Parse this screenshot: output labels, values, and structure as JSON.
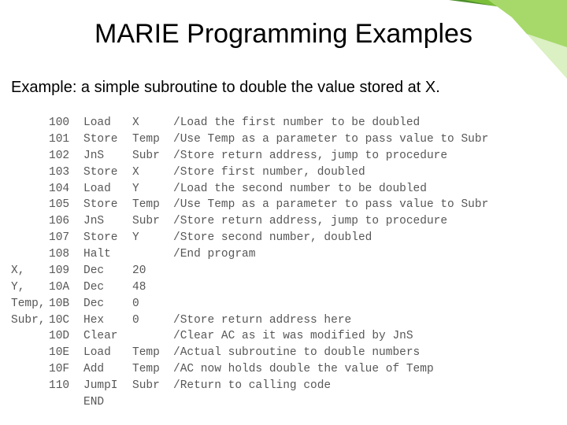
{
  "title": "MARIE Programming Examples",
  "subtitle": "Example: a simple subroutine to double the value stored at X.",
  "code": [
    {
      "label": "",
      "addr": "100",
      "op": "Load",
      "arg": "X",
      "comment": "/Load the first number to be doubled"
    },
    {
      "label": "",
      "addr": "101",
      "op": "Store",
      "arg": "Temp",
      "comment": "/Use Temp as a parameter to pass value to Subr"
    },
    {
      "label": "",
      "addr": "102",
      "op": "JnS",
      "arg": "Subr",
      "comment": "/Store return address, jump to procedure"
    },
    {
      "label": "",
      "addr": "103",
      "op": "Store",
      "arg": "X",
      "comment": "/Store first number, doubled"
    },
    {
      "label": "",
      "addr": "104",
      "op": "Load",
      "arg": "Y",
      "comment": "/Load the second number to be doubled"
    },
    {
      "label": "",
      "addr": "105",
      "op": "Store",
      "arg": "Temp",
      "comment": "/Use Temp as a parameter to pass value to Subr"
    },
    {
      "label": "",
      "addr": "106",
      "op": "JnS",
      "arg": "Subr",
      "comment": "/Store return address, jump to procedure"
    },
    {
      "label": "",
      "addr": "107",
      "op": "Store",
      "arg": "Y",
      "comment": "/Store second number, doubled"
    },
    {
      "label": "",
      "addr": "108",
      "op": "Halt",
      "arg": "",
      "comment": "/End program"
    },
    {
      "label": "X,",
      "addr": "109",
      "op": "Dec",
      "arg": "20",
      "comment": ""
    },
    {
      "label": "Y,",
      "addr": "10A",
      "op": "Dec",
      "arg": "48",
      "comment": ""
    },
    {
      "label": "Temp,",
      "addr": "10B",
      "op": "Dec",
      "arg": "0",
      "comment": ""
    },
    {
      "label": "Subr,",
      "addr": "10C",
      "op": "Hex",
      "arg": "0",
      "comment": "/Store return address here"
    },
    {
      "label": "",
      "addr": "10D",
      "op": "Clear",
      "arg": "",
      "comment": "/Clear AC as it was modified by JnS"
    },
    {
      "label": "",
      "addr": "10E",
      "op": "Load",
      "arg": "Temp",
      "comment": "/Actual subroutine to double numbers"
    },
    {
      "label": "",
      "addr": "10F",
      "op": "Add",
      "arg": "Temp",
      "comment": "/AC now holds double the value of Temp"
    },
    {
      "label": "",
      "addr": "110",
      "op": "JumpI",
      "arg": "Subr",
      "comment": "/Return to calling code"
    },
    {
      "label": "",
      "addr": "",
      "op": "END",
      "arg": "",
      "comment": ""
    }
  ]
}
